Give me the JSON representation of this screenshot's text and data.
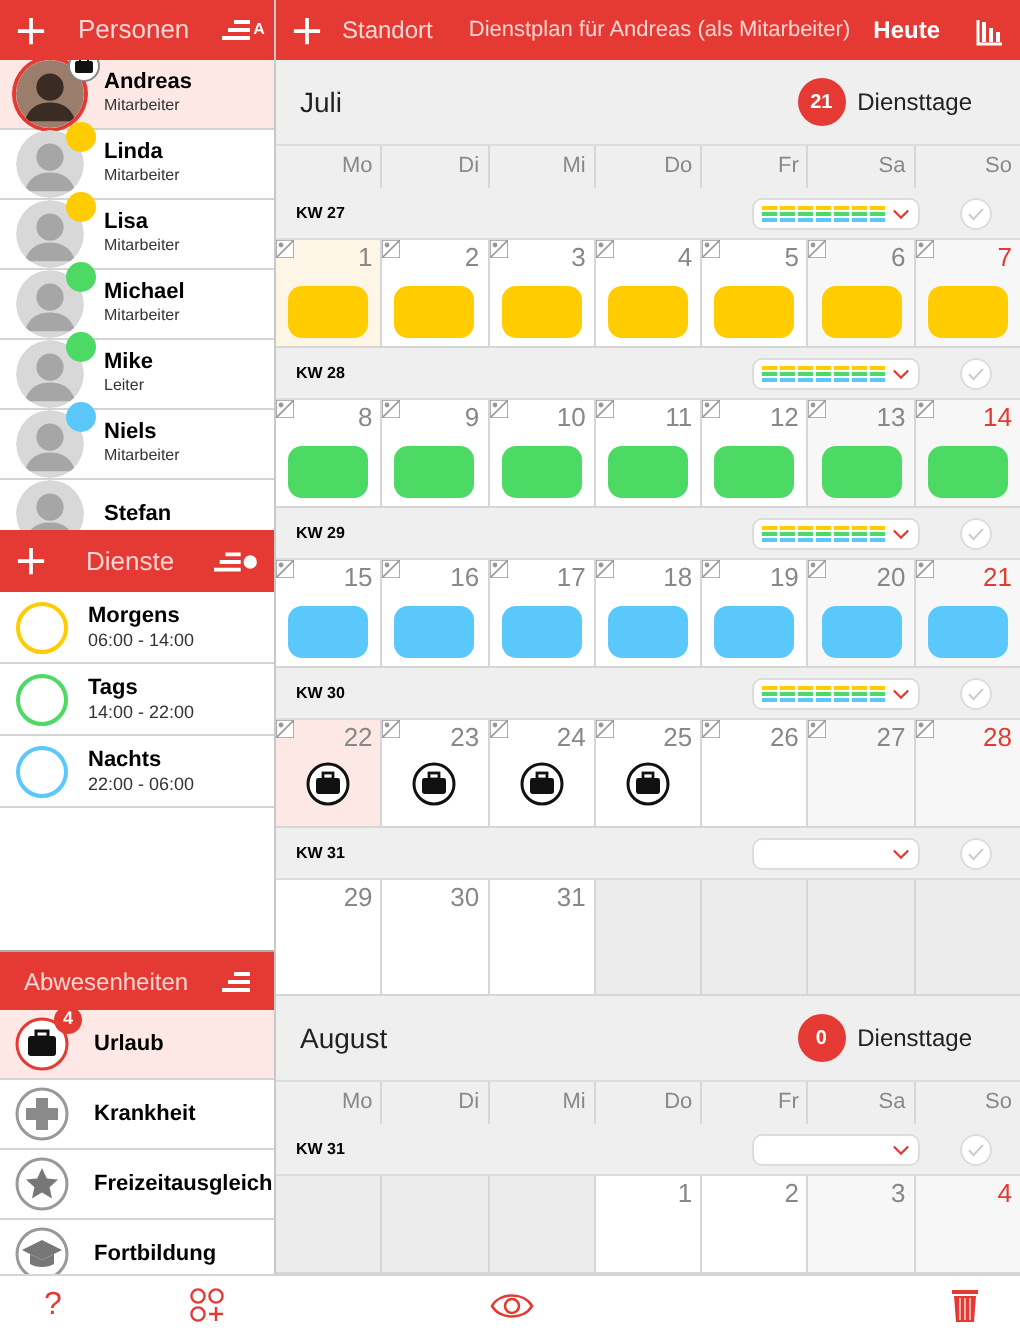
{
  "persons_panel": {
    "title": "Personen",
    "sort_label": "A",
    "items": [
      {
        "name": "Andreas",
        "role": "Mitarbeiter",
        "selected": true,
        "absent": true
      },
      {
        "name": "Linda",
        "role": "Mitarbeiter",
        "selected": false,
        "absent": false,
        "color": "#ffcc00"
      },
      {
        "name": "Lisa",
        "role": "Mitarbeiter",
        "selected": false,
        "absent": false,
        "color": "#ffcc00"
      },
      {
        "name": "Michael",
        "role": "Mitarbeiter",
        "selected": false,
        "absent": false,
        "color": "#4cd964"
      },
      {
        "name": "Mike",
        "role": "Leiter",
        "selected": false,
        "absent": false,
        "color": "#4cd964"
      },
      {
        "name": "Niels",
        "role": "Mitarbeiter",
        "selected": false,
        "absent": false,
        "color": "#5ac8fa"
      },
      {
        "name": "Stefan",
        "selected": false,
        "absent": false
      }
    ]
  },
  "shifts_panel": {
    "title": "Dienste",
    "items": [
      {
        "name": "Morgens",
        "time": "06:00 - 14:00",
        "color": "#ffcc00"
      },
      {
        "name": "Tags",
        "time": "14:00 - 22:00",
        "color": "#4cd964"
      },
      {
        "name": "Nachts",
        "time": "22:00 - 06:00",
        "color": "#5ac8fa"
      }
    ]
  },
  "absences_panel": {
    "title": "Abwesenheiten",
    "items": [
      {
        "name": "Urlaub",
        "kind": "briefcase",
        "count": "4",
        "selected": true
      },
      {
        "name": "Krankheit",
        "kind": "cross",
        "selected": false
      },
      {
        "name": "Freizeitausgleich",
        "kind": "star",
        "selected": false
      },
      {
        "name": "Fortbildung",
        "kind": "cap",
        "selected": false
      }
    ]
  },
  "toolbar": {
    "location": "Standort",
    "title": "Dienstplan für Andreas (als Mitarbeiter)",
    "today": "Heute"
  },
  "months": [
    {
      "name": "Juli",
      "count": "21",
      "count_label": "Diensttage",
      "weekdays": [
        "Mo",
        "Di",
        "Mi",
        "Do",
        "Fr",
        "Sa",
        "So"
      ],
      "weeks": [
        {
          "label": "KW 27",
          "planned": true,
          "checked": false,
          "days": [
            {
              "kind": "weekday",
              "day": "1",
              "today": true,
              "selected": false,
              "note": true,
              "absence": false,
              "color": "#ffcc00"
            },
            {
              "kind": "weekday",
              "day": "2",
              "today": false,
              "selected": false,
              "note": true,
              "absence": false,
              "color": "#ffcc00"
            },
            {
              "kind": "weekday",
              "day": "3",
              "today": false,
              "selected": false,
              "note": true,
              "absence": false,
              "color": "#ffcc00"
            },
            {
              "kind": "weekday",
              "day": "4",
              "today": false,
              "selected": false,
              "note": true,
              "absence": false,
              "color": "#ffcc00"
            },
            {
              "kind": "weekday",
              "day": "5",
              "today": false,
              "selected": false,
              "note": true,
              "absence": false,
              "color": "#ffcc00"
            },
            {
              "kind": "saturday",
              "day": "6",
              "today": false,
              "selected": false,
              "note": true,
              "absence": false,
              "color": "#ffcc00"
            },
            {
              "kind": "sunday",
              "day": "7",
              "today": false,
              "selected": false,
              "note": true,
              "absence": false,
              "color": "#ffcc00"
            }
          ]
        },
        {
          "label": "KW 28",
          "planned": true,
          "checked": false,
          "days": [
            {
              "kind": "weekday",
              "day": "8",
              "today": false,
              "selected": false,
              "note": true,
              "absence": false,
              "color": "#4cd964"
            },
            {
              "kind": "weekday",
              "day": "9",
              "today": false,
              "selected": false,
              "note": true,
              "absence": false,
              "color": "#4cd964"
            },
            {
              "kind": "weekday",
              "day": "10",
              "today": false,
              "selected": false,
              "note": true,
              "absence": false,
              "color": "#4cd964"
            },
            {
              "kind": "weekday",
              "day": "11",
              "today": false,
              "selected": false,
              "note": true,
              "absence": false,
              "color": "#4cd964"
            },
            {
              "kind": "weekday",
              "day": "12",
              "today": false,
              "selected": false,
              "note": true,
              "absence": false,
              "color": "#4cd964"
            },
            {
              "kind": "saturday",
              "day": "13",
              "today": false,
              "selected": false,
              "note": true,
              "absence": false,
              "color": "#4cd964"
            },
            {
              "kind": "sunday",
              "day": "14",
              "today": false,
              "selected": false,
              "note": true,
              "absence": false,
              "color": "#4cd964"
            }
          ]
        },
        {
          "label": "KW 29",
          "planned": true,
          "checked": false,
          "days": [
            {
              "kind": "weekday",
              "day": "15",
              "today": false,
              "selected": false,
              "note": true,
              "absence": false,
              "color": "#5ac8fa"
            },
            {
              "kind": "weekday",
              "day": "16",
              "today": false,
              "selected": false,
              "note": true,
              "absence": false,
              "color": "#5ac8fa"
            },
            {
              "kind": "weekday",
              "day": "17",
              "today": false,
              "selected": false,
              "note": true,
              "absence": false,
              "color": "#5ac8fa"
            },
            {
              "kind": "weekday",
              "day": "18",
              "today": false,
              "selected": false,
              "note": true,
              "absence": false,
              "color": "#5ac8fa"
            },
            {
              "kind": "weekday",
              "day": "19",
              "today": false,
              "selected": false,
              "note": true,
              "absence": false,
              "color": "#5ac8fa"
            },
            {
              "kind": "saturday",
              "day": "20",
              "today": false,
              "selected": false,
              "note": true,
              "absence": false,
              "color": "#5ac8fa"
            },
            {
              "kind": "sunday",
              "day": "21",
              "today": false,
              "selected": false,
              "note": true,
              "absence": false,
              "color": "#5ac8fa"
            }
          ]
        },
        {
          "label": "KW 30",
          "planned": true,
          "checked": false,
          "days": [
            {
              "kind": "weekday",
              "day": "22",
              "today": false,
              "selected": true,
              "note": true,
              "absence": true
            },
            {
              "kind": "weekday",
              "day": "23",
              "today": false,
              "selected": false,
              "note": true,
              "absence": true
            },
            {
              "kind": "weekday",
              "day": "24",
              "today": false,
              "selected": false,
              "note": true,
              "absence": true
            },
            {
              "kind": "weekday",
              "day": "25",
              "today": false,
              "selected": false,
              "note": true,
              "absence": true
            },
            {
              "kind": "weekday",
              "day": "26",
              "today": false,
              "selected": false,
              "note": true,
              "absence": false
            },
            {
              "kind": "saturday",
              "day": "27",
              "today": false,
              "selected": false,
              "note": true,
              "absence": false
            },
            {
              "kind": "sunday",
              "day": "28",
              "today": false,
              "selected": false,
              "note": true,
              "absence": false
            }
          ]
        },
        {
          "label": "KW 31",
          "planned": false,
          "checked": false,
          "days": [
            {
              "kind": "weekday",
              "day": "29",
              "today": false,
              "selected": false,
              "note": false,
              "absence": false
            },
            {
              "kind": "weekday",
              "day": "30",
              "today": false,
              "selected": false,
              "note": false,
              "absence": false
            },
            {
              "kind": "weekday",
              "day": "31",
              "today": false,
              "selected": false,
              "note": false,
              "absence": false
            },
            {
              "kind": "blank"
            },
            {
              "kind": "blank"
            },
            {
              "kind": "blank"
            },
            {
              "kind": "blank"
            }
          ]
        }
      ]
    },
    {
      "name": "August",
      "count": "0",
      "count_label": "Diensttage",
      "weekdays": [
        "Mo",
        "Di",
        "Mi",
        "Do",
        "Fr",
        "Sa",
        "So"
      ],
      "weeks": [
        {
          "label": "KW 31",
          "planned": false,
          "checked": false,
          "days": [
            {
              "kind": "blank"
            },
            {
              "kind": "blank"
            },
            {
              "kind": "blank"
            },
            {
              "kind": "weekday",
              "day": "1",
              "today": false,
              "selected": false,
              "note": false,
              "absence": false
            },
            {
              "kind": "weekday",
              "day": "2",
              "today": false,
              "selected": false,
              "note": false,
              "absence": false
            },
            {
              "kind": "saturday",
              "day": "3",
              "today": false,
              "selected": false,
              "note": false,
              "absence": false
            },
            {
              "kind": "sunday",
              "day": "4",
              "today": false,
              "selected": false,
              "note": false,
              "absence": false
            }
          ]
        }
      ]
    }
  ],
  "bottom_bar": {
    "help": "?"
  }
}
